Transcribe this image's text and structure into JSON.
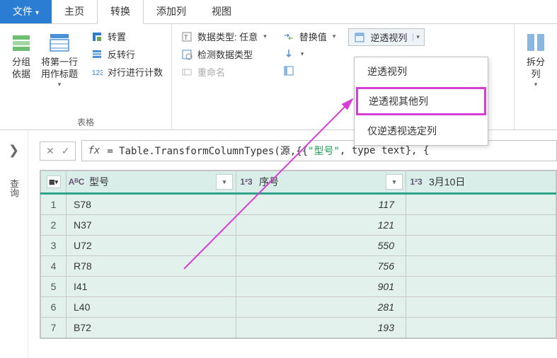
{
  "tabs": {
    "file": "文件",
    "home": "主页",
    "transform": "转换",
    "addcol": "添加列",
    "view": "视图"
  },
  "ribbon": {
    "group1": {
      "groupby": "分组\n依据",
      "firstrow": "将第一行\n用作标题",
      "label": "表格"
    },
    "group2": {
      "transpose": "转置",
      "reverse": "反转行",
      "count": "对行进行计数"
    },
    "group3": {
      "datatype": "数据类型: 任意",
      "detect": "检测数据类型",
      "rename": "重命名",
      "replace": "替换值",
      "fill_icon": "",
      "pivot_icon": "",
      "unpivot": "逆透视列"
    },
    "group4": {
      "split": "拆分\n列"
    }
  },
  "dropdown": {
    "item1": "逆透视列",
    "item2": "逆透视其他列",
    "item3": "仅逆透视选定列"
  },
  "formula": {
    "prefix": "= Table.TransformColumnTypes(源,{{",
    "str": "\"型号\"",
    "mid": ", type text}, {"
  },
  "columns": {
    "c1_type": "AᴮC",
    "c1": "型号",
    "c2_type": "1²3",
    "c2": "序号",
    "c3_type": "1²3",
    "c3": "3月10日"
  },
  "rows": [
    {
      "n": "1",
      "a": "S78",
      "b": "117"
    },
    {
      "n": "2",
      "a": "N37",
      "b": "121"
    },
    {
      "n": "3",
      "a": "U72",
      "b": "550"
    },
    {
      "n": "4",
      "a": "R78",
      "b": "756"
    },
    {
      "n": "5",
      "a": "I41",
      "b": "901"
    },
    {
      "n": "6",
      "a": "L40",
      "b": "281"
    },
    {
      "n": "7",
      "a": "B72",
      "b": "193"
    }
  ],
  "side_label": "查询"
}
